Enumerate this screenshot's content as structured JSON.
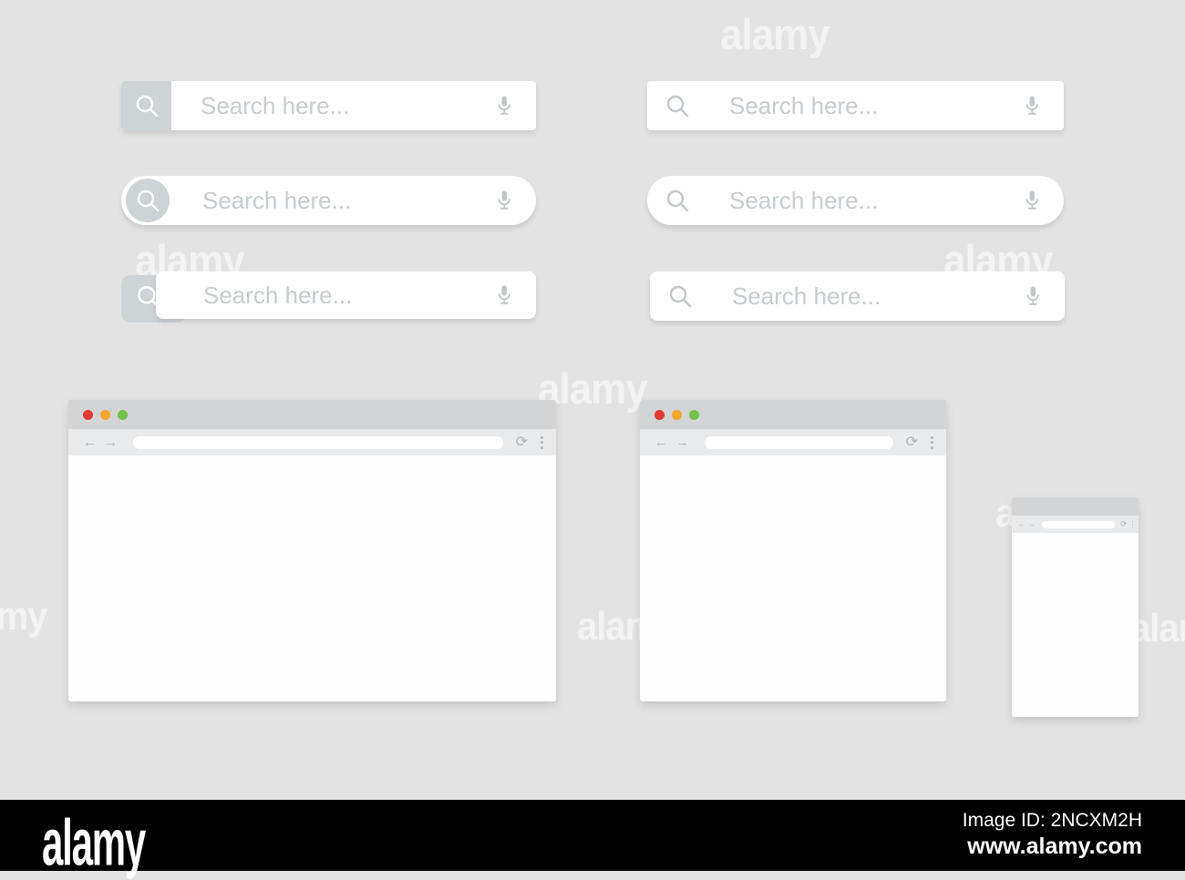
{
  "colors": {
    "background": "#e4e3e3",
    "bar_white": "#ffffff",
    "icon_box_gray": "#ced3d5",
    "placeholder_gray": "#c7cccf",
    "icon_gray": "#c2c7c9",
    "titlebar_gray": "#d2d4d5",
    "toolbar_gray": "#e9eaeb",
    "dot_red": "#e23b35",
    "dot_orange": "#f4a72c",
    "dot_green": "#76c14b",
    "footer_bg": "#000000"
  },
  "search_bars": {
    "placeholder": "Search here...",
    "left_icon": "magnifier-icon",
    "right_icon": "microphone-icon"
  },
  "browser_window": {
    "back_glyph": "←",
    "forward_glyph": "→",
    "refresh_glyph": "⟳",
    "url_value": ""
  },
  "watermark": {
    "text": "alamy"
  },
  "footer": {
    "logo": "alamy",
    "image_id": "Image ID: 2NCXM2H",
    "url": "www.alamy.com"
  }
}
